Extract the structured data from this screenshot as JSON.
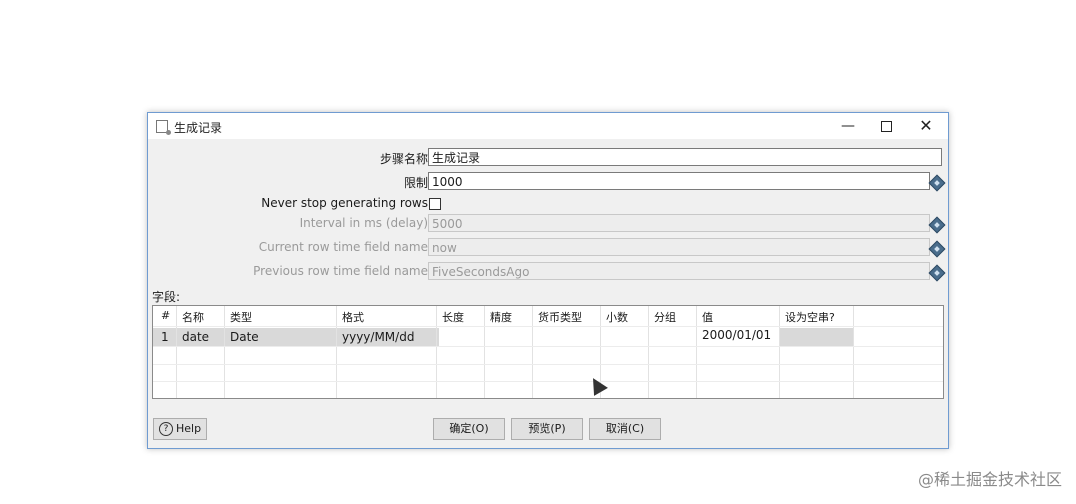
{
  "window": {
    "title": "生成记录",
    "minimize": "—",
    "close": "✕"
  },
  "form": {
    "step_name": {
      "label": "步骤名称",
      "value": "生成记录"
    },
    "limit": {
      "label": "限制",
      "value": "1000"
    },
    "never_stop": {
      "label": "Never stop generating rows",
      "checked": false
    },
    "interval": {
      "label": "Interval in ms (delay)",
      "value": "5000"
    },
    "current_row_time": {
      "label": "Current row time field name",
      "value": "now"
    },
    "previous_row_time": {
      "label": "Previous row time field name",
      "value": "FiveSecondsAgo"
    }
  },
  "fields": {
    "label": "字段:",
    "columns": [
      "#",
      "名称",
      "类型",
      "格式",
      "长度",
      "精度",
      "货币类型",
      "小数",
      "分组",
      "值",
      "设为空串?"
    ],
    "rows": [
      [
        "1",
        "date",
        "Date",
        "yyyy/MM/dd",
        "",
        "",
        "",
        "",
        "",
        "2000/01/01",
        ""
      ]
    ]
  },
  "buttons": {
    "help": "Help",
    "ok": "确定(O)",
    "preview": "预览(P)",
    "cancel": "取消(C)"
  },
  "watermark": "@稀土掘金技术社区"
}
